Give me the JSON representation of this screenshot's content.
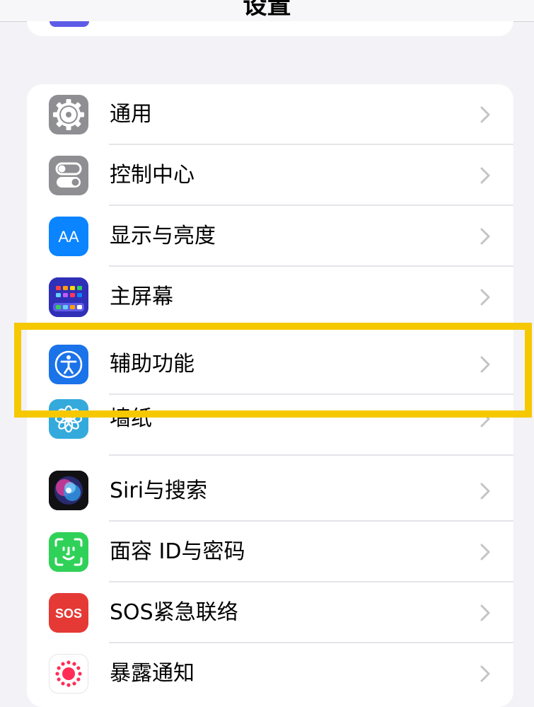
{
  "nav": {
    "title": "设置"
  },
  "rows": [
    {
      "label": "通用",
      "icon": "gear-icon",
      "color": "#8e8e93"
    },
    {
      "label": "控制中心",
      "icon": "toggles-icon",
      "color": "#8e8e93"
    },
    {
      "label": "显示与亮度",
      "icon": "text-size-icon",
      "color": "#0a84ff",
      "icon_text": "AA"
    },
    {
      "label": "主屏幕",
      "icon": "home-screen-grid-icon",
      "color": "#3a3ad8"
    },
    {
      "label": "辅助功能",
      "icon": "accessibility-icon",
      "color": "#1a73e8"
    },
    {
      "label": "墙纸",
      "icon": "flower-icon",
      "color": "#34aadc"
    },
    {
      "label": "Siri与搜索",
      "icon": "siri-icon",
      "color": "#1c1c1e"
    },
    {
      "label": "面容 ID与密码",
      "icon": "face-id-icon",
      "color": "#30d158"
    },
    {
      "label": "SOS紧急联络",
      "icon": "sos-icon",
      "color": "#e53935",
      "icon_text": "SOS"
    },
    {
      "label": "暴露通知",
      "icon": "exposure-notification-icon",
      "color": "#ffffff"
    }
  ],
  "highlight": {
    "target": "辅助功能",
    "color": "#f5c800"
  }
}
